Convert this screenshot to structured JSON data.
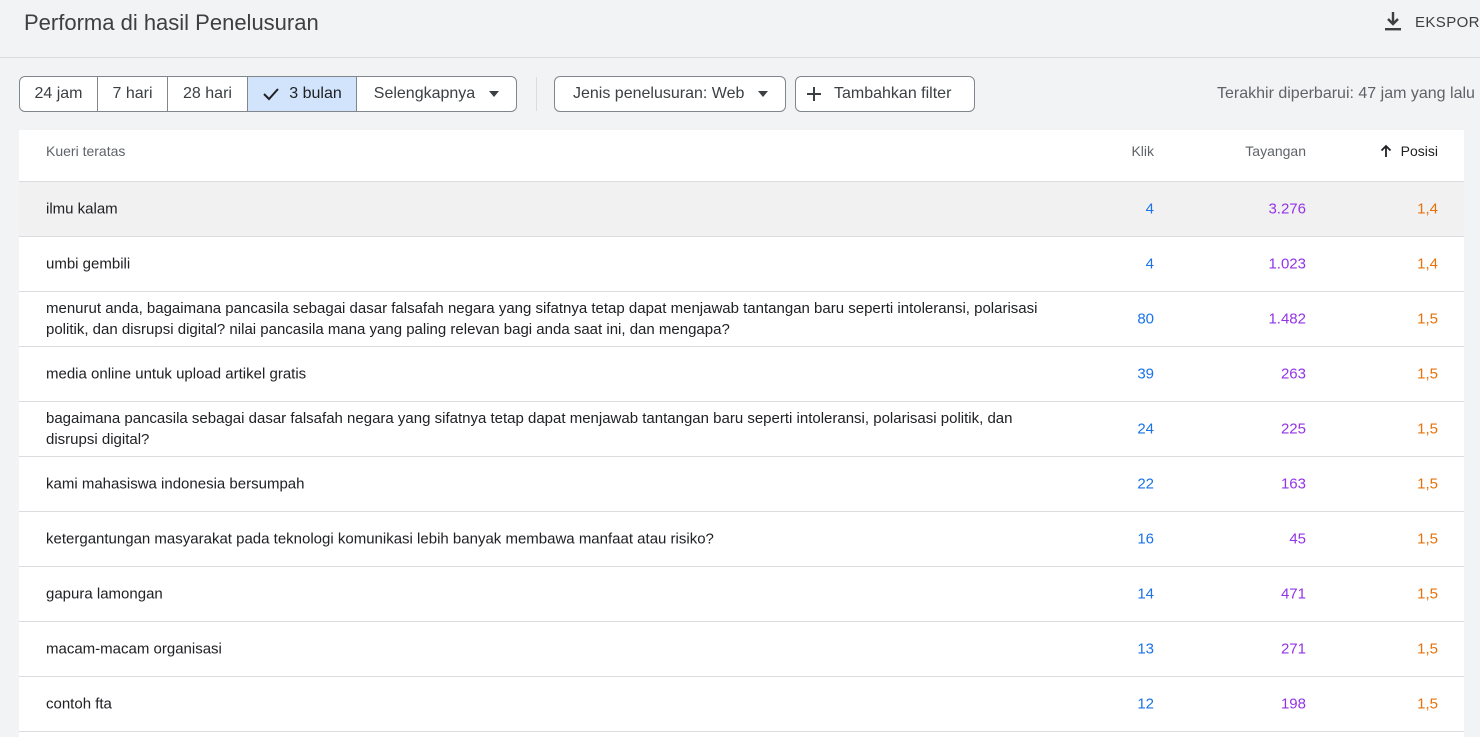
{
  "header": {
    "title": "Performa di hasil Penelusuran",
    "export_label": "EKSPOR",
    "export_icon": "download-icon"
  },
  "filters": {
    "date_ranges": [
      "24 jam",
      "7 hari",
      "28 hari",
      "3 bulan",
      "Selengkapnya"
    ],
    "selected_range": "3 bulan",
    "search_type": "Jenis penelusuran: Web",
    "add_filter": "Tambahkan filter",
    "last_updated": "Terakhir diperbarui: 47 jam yang lalu"
  },
  "table": {
    "columns": {
      "query": "Kueri teratas",
      "clicks": "Klik",
      "impressions": "Tayangan",
      "position": "Posisi"
    },
    "sort": {
      "column": "Posisi",
      "direction": "ascending"
    },
    "rows": [
      {
        "query": "ilmu kalam",
        "clicks": "4",
        "impressions": "3.276",
        "position": "1,4"
      },
      {
        "query": "umbi gembili",
        "clicks": "4",
        "impressions": "1.023",
        "position": "1,4"
      },
      {
        "query": "menurut anda, bagaimana pancasila sebagai dasar falsafah negara yang sifatnya tetap dapat menjawab tantangan baru seperti intoleransi, polarisasi politik, dan disrupsi digital? nilai pancasila mana yang paling relevan bagi anda saat ini, dan mengapa?",
        "clicks": "80",
        "impressions": "1.482",
        "position": "1,5"
      },
      {
        "query": "media online untuk upload artikel gratis",
        "clicks": "39",
        "impressions": "263",
        "position": "1,5"
      },
      {
        "query": "bagaimana pancasila sebagai dasar falsafah negara yang sifatnya tetap dapat menjawab tantangan baru seperti intoleransi, polarisasi politik, dan disrupsi digital?",
        "clicks": "24",
        "impressions": "225",
        "position": "1,5"
      },
      {
        "query": "kami mahasiswa indonesia bersumpah",
        "clicks": "22",
        "impressions": "163",
        "position": "1,5"
      },
      {
        "query": "ketergantungan masyarakat pada teknologi komunikasi lebih banyak membawa manfaat atau risiko?",
        "clicks": "16",
        "impressions": "45",
        "position": "1,5"
      },
      {
        "query": "gapura lamongan",
        "clicks": "14",
        "impressions": "471",
        "position": "1,5"
      },
      {
        "query": "macam-macam organisasi",
        "clicks": "13",
        "impressions": "271",
        "position": "1,5"
      },
      {
        "query": "contoh fta",
        "clicks": "12",
        "impressions": "198",
        "position": "1,5"
      }
    ]
  },
  "colors": {
    "clicks": "#1a73e8",
    "impressions": "#9334e6",
    "position": "#e8710a",
    "selected_chip": "#d2e3fc"
  }
}
